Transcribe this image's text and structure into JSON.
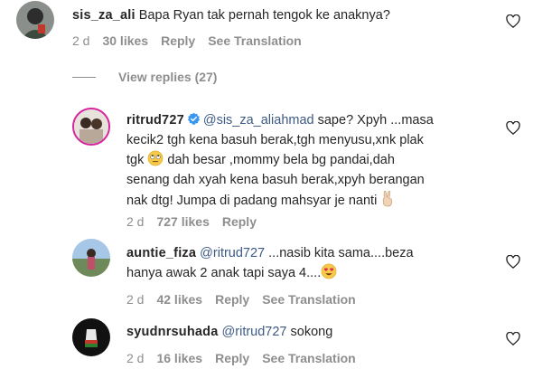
{
  "comments": [
    {
      "username": "sis_za_ali",
      "text": "Bapa Ryan tak pernah tengok ke anaknya?",
      "time": "2 d",
      "likes": "30 likes",
      "reply": "Reply",
      "translation": "See Translation"
    },
    {
      "username": "ritrud727",
      "mention": "@sis_za_aliahmad",
      "line1": " sape? Xpyh ...masa",
      "line2": "kecik2 tgh kena basuh berak,tgh menyusu,xnk plak",
      "line3a": "tgk ",
      "line3b": " dah besar ,mommy bela bg pandai,dah",
      "line4": "senang dah xyah kena basuh berak,xpyh berangan",
      "line5": "nak dtg! Jumpa di padang mahsyar je nanti ",
      "time": "2 d",
      "likes": "727 likes",
      "reply": "Reply"
    },
    {
      "username": "auntie_fiza",
      "mention": "@ritrud727",
      "line1": " ...nasib kita sama....beza",
      "line2": "hanya awak 2 anak tapi saya 4....",
      "time": "2 d",
      "likes": "42 likes",
      "reply": "Reply",
      "translation": "See Translation"
    },
    {
      "username": "syudnrsuhada",
      "mention": "@ritrud727",
      "text": " sokong",
      "time": "2 d",
      "likes": "16 likes",
      "reply": "Reply",
      "translation": "See Translation"
    }
  ],
  "view_replies": "View replies (27)",
  "colors": {
    "mention": "#3d5a85",
    "meta": "#8e8e8e",
    "verified": "#3897f0"
  }
}
